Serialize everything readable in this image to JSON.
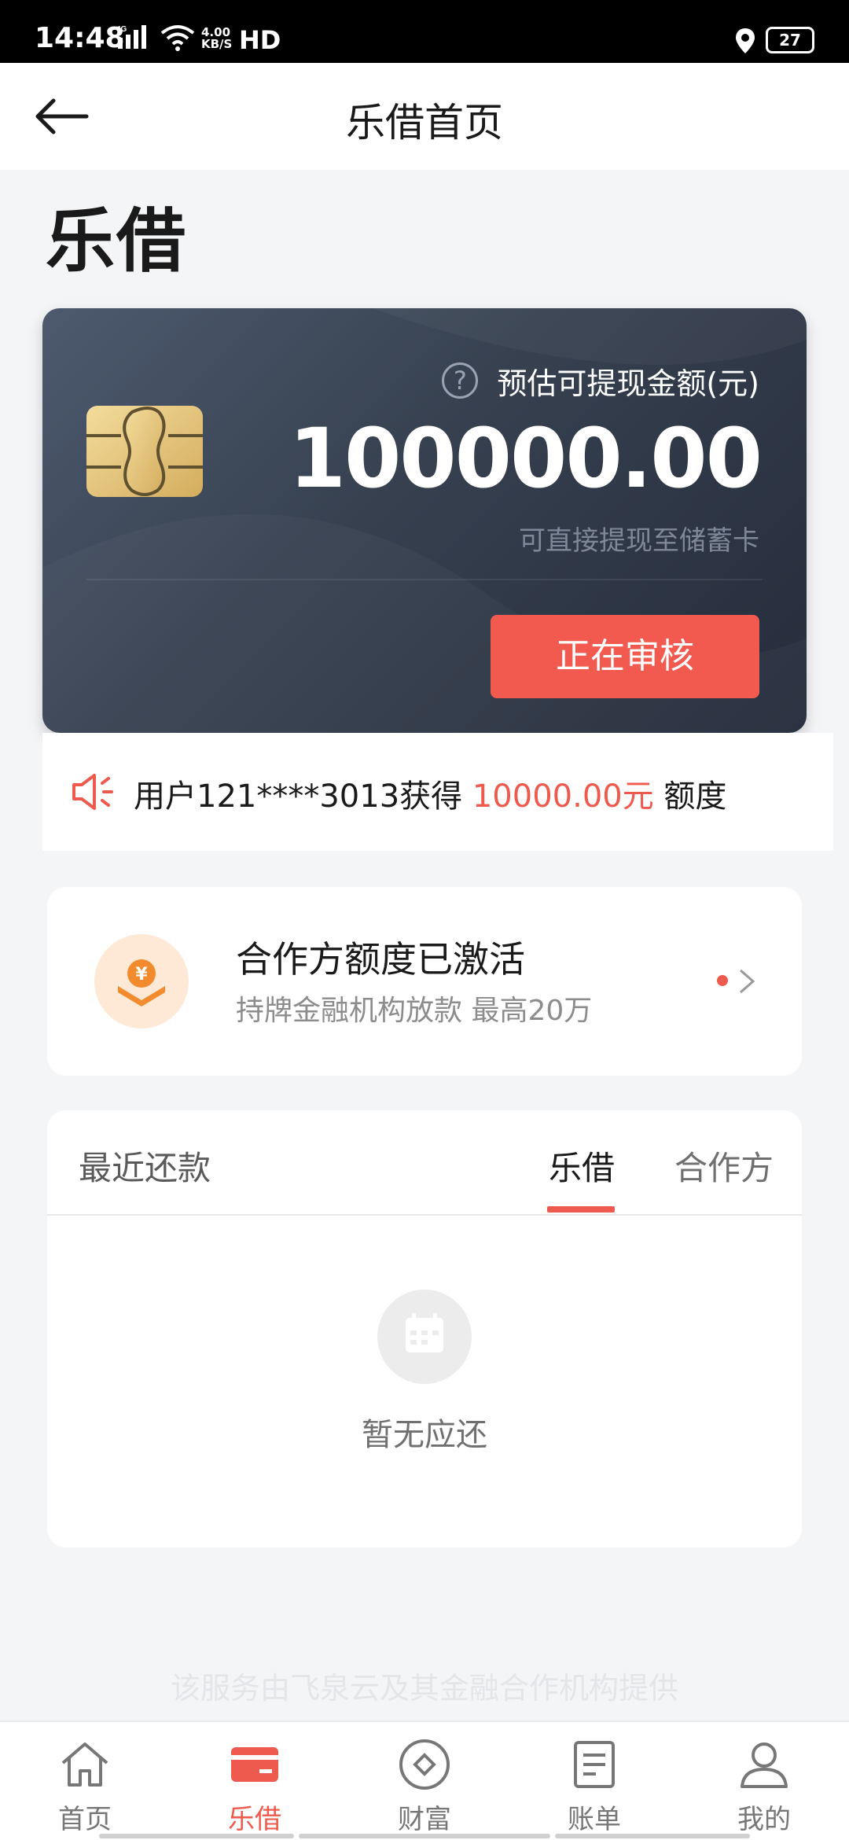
{
  "status_bar": {
    "time": "14:48",
    "network": "4G",
    "speed_value": "4.00",
    "speed_unit": "KB/S",
    "hd": "HD",
    "battery": "27"
  },
  "nav": {
    "title": "乐借首页",
    "back_icon": "arrow-left-icon"
  },
  "page_heading": "乐借",
  "card": {
    "label": "预估可提现金额(元)",
    "amount": "100000.00",
    "subtitle": "可直接提现至储蓄卡",
    "button_label": "正在审核",
    "help_glyph": "?"
  },
  "notice": {
    "prefix": "用户121****3013获得 ",
    "highlight": "10000.00元",
    "suffix": " 额度",
    "icon": "megaphone-icon"
  },
  "partner": {
    "title": "合作方额度已激活",
    "subtitle": "持牌金融机构放款 最高20万",
    "icon": "yuan-hand-icon"
  },
  "repayment": {
    "title": "最近还款",
    "tabs": [
      {
        "label": "乐借",
        "active": true
      },
      {
        "label": "合作方",
        "active": false
      }
    ],
    "empty_text": "暂无应还"
  },
  "footer_note": "该服务由飞泉云及其金融合作机构提供",
  "tabbar": {
    "items": [
      {
        "label": "首页",
        "icon": "home-icon",
        "active": false
      },
      {
        "label": "乐借",
        "icon": "card-icon",
        "active": true
      },
      {
        "label": "财富",
        "icon": "diamond-circle-icon",
        "active": false
      },
      {
        "label": "账单",
        "icon": "document-icon",
        "active": false
      },
      {
        "label": "我的",
        "icon": "user-icon",
        "active": false
      }
    ]
  },
  "colors": {
    "accent": "#ee5a4e",
    "button": "#f25a50",
    "card_dark": "#252c3b",
    "card_light": "#4d5a6e",
    "chip_gold": "#e8c97a"
  }
}
